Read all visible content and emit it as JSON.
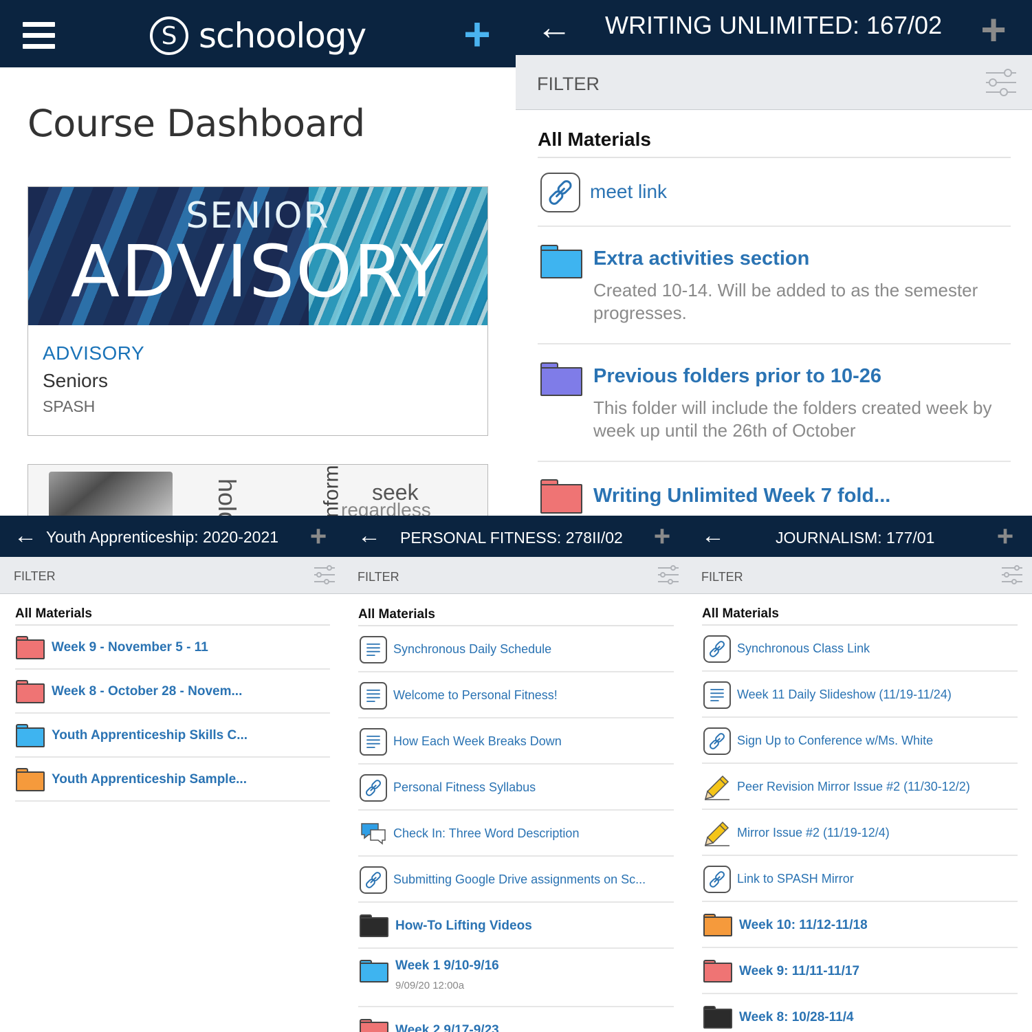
{
  "dashboard": {
    "logo_glyph": "S",
    "logo_text": "schoology",
    "plus_glyph": "+",
    "title": "Course Dashboard",
    "course": {
      "banner_line1": "SENIOR",
      "banner_line2": "ADVISORY",
      "name": "ADVISORY",
      "section": "Seniors",
      "school": "SPASH"
    },
    "next_card_words": [
      "hold",
      "inform",
      "seek",
      "regardless without"
    ]
  },
  "writing": {
    "back_glyph": "←",
    "title": "WRITING UNLIMITED: 167/02",
    "plus_glyph": "+",
    "filter_label": "FILTER",
    "section_label": "All Materials",
    "items": [
      {
        "type": "link",
        "title": "meet link",
        "icon": "link-icon"
      },
      {
        "type": "folder",
        "title": "Extra activities section",
        "description": "Created 10-14. Will be added to as the semester progresses.",
        "icon": "folder-icon",
        "color": "#3eb4f0"
      },
      {
        "type": "folder",
        "title": "Previous folders prior to 10-26",
        "description": "This folder will include the folders created week by week up until the 26th of October",
        "icon": "folder-icon",
        "color": "#7f7ce8"
      },
      {
        "type": "folder",
        "title": "Writing Unlimited Week 7 fold...",
        "icon": "folder-icon",
        "color": "#ef7474"
      }
    ]
  },
  "youth": {
    "back_glyph": "←",
    "title": "Youth Apprenticeship: 2020-2021",
    "plus_glyph": "+",
    "filter_label": "FILTER",
    "section_label": "All Materials",
    "items": [
      {
        "type": "folder",
        "title": "Week 9 - November 5 - 11",
        "icon": "folder-icon",
        "color": "#ef7474"
      },
      {
        "type": "folder",
        "title": "Week 8 - October 28 - Novem...",
        "icon": "folder-icon",
        "color": "#ef7474"
      },
      {
        "type": "folder",
        "title": "Youth Apprenticeship Skills C...",
        "icon": "folder-icon",
        "color": "#3eb4f0"
      },
      {
        "type": "folder",
        "title": "Youth Apprenticeship Sample...",
        "icon": "folder-icon",
        "color": "#f59a3c"
      }
    ]
  },
  "fitness": {
    "back_glyph": "←",
    "title": "PERSONAL FITNESS: 278II/02",
    "plus_glyph": "+",
    "filter_label": "FILTER",
    "section_label": "All Materials",
    "items": [
      {
        "type": "page",
        "title": "Synchronous Daily Schedule",
        "icon": "document-icon"
      },
      {
        "type": "page",
        "title": "Welcome to Personal Fitness!",
        "icon": "document-icon"
      },
      {
        "type": "page",
        "title": "How Each Week Breaks Down",
        "icon": "document-icon"
      },
      {
        "type": "link",
        "title": "Personal Fitness Syllabus",
        "icon": "link-icon"
      },
      {
        "type": "discussion",
        "title": "Check In: Three Word Description",
        "icon": "discussion-icon"
      },
      {
        "type": "link",
        "title": "Submitting Google Drive assignments on Sc...",
        "icon": "link-icon"
      },
      {
        "type": "folder",
        "title": "How-To Lifting Videos",
        "icon": "folder-icon",
        "color": "#2b2b2b"
      },
      {
        "type": "folder",
        "title": "Week 1 9/10-9/16",
        "date": "9/09/20 12:00a",
        "icon": "folder-icon",
        "color": "#3eb4f0"
      },
      {
        "type": "folder",
        "title": "Week 2 9/17-9/23",
        "icon": "folder-icon",
        "color": "#ef7474"
      }
    ]
  },
  "journalism": {
    "back_glyph": "←",
    "title": "JOURNALISM: 177/01",
    "plus_glyph": "+",
    "filter_label": "FILTER",
    "section_label": "All Materials",
    "items": [
      {
        "type": "link",
        "title": "Synchronous Class Link",
        "icon": "link-icon"
      },
      {
        "type": "page",
        "title": "Week 11 Daily Slideshow (11/19-11/24)",
        "icon": "document-icon"
      },
      {
        "type": "link",
        "title": "Sign Up to Conference w/Ms. White",
        "icon": "link-icon"
      },
      {
        "type": "assignment",
        "title": "Peer Revision Mirror Issue #2 (11/30-12/2)",
        "icon": "pencil-icon"
      },
      {
        "type": "assignment",
        "title": "Mirror Issue #2 (11/19-12/4)",
        "icon": "pencil-icon"
      },
      {
        "type": "link",
        "title": "Link to SPASH Mirror",
        "icon": "link-icon"
      },
      {
        "type": "folder",
        "title": "Week 10: 11/12-11/18",
        "icon": "folder-icon",
        "color": "#f59a3c"
      },
      {
        "type": "folder",
        "title": "Week 9: 11/11-11/17",
        "icon": "folder-icon",
        "color": "#ef7474"
      },
      {
        "type": "folder",
        "title": "Week 8: 10/28-11/4",
        "icon": "folder-icon",
        "color": "#2b2b2b"
      }
    ]
  }
}
